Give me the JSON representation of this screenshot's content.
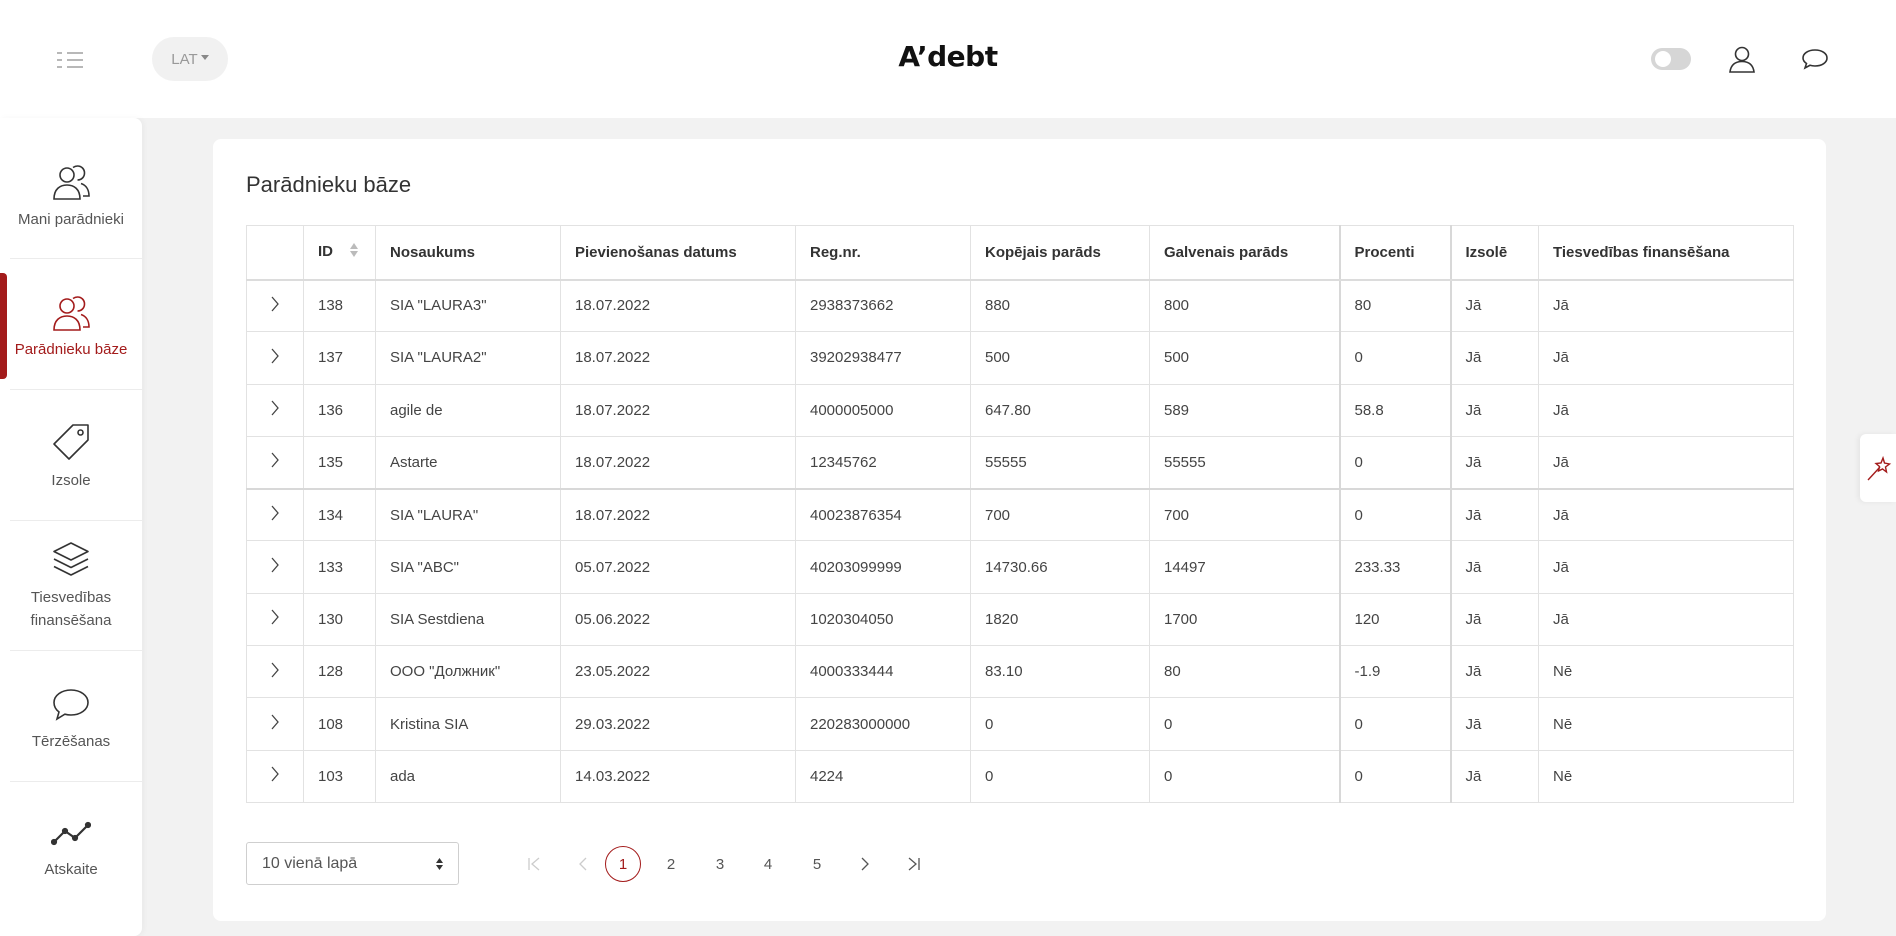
{
  "header": {
    "logo": "A’debt",
    "language": "LAT",
    "icons": {
      "menu": "list-menu-icon",
      "user": "user-icon",
      "chat": "chat-bubble-icon"
    },
    "theme_toggle_on": false
  },
  "sidebar": {
    "items": [
      {
        "label": "Mani parādnieki",
        "icon": "users-icon",
        "active": false
      },
      {
        "label": "Parādnieku bāze",
        "icon": "users-icon",
        "active": true
      },
      {
        "label": "Izsole",
        "icon": "tag-icon",
        "active": false
      },
      {
        "label": "Tiesvedības finansēšana",
        "line1": "Tiesvedības",
        "line2": "finansēšana",
        "icon": "layers-icon",
        "active": false
      },
      {
        "label": "Tērzēšanas",
        "icon": "chat-bubble-icon",
        "active": false
      },
      {
        "label": "Atskaite",
        "icon": "line-chart-icon",
        "active": false
      }
    ]
  },
  "main": {
    "title": "Parādnieku bāze",
    "columns": [
      "",
      "ID",
      "Nosaukums",
      "Pievienošanas datums",
      "Reg.nr.",
      "Kopējais parāds",
      "Galvenais parāds",
      "Procenti",
      "Izsolē",
      "Tiesvedības finansēšana"
    ],
    "rows": [
      [
        "138",
        "SIA \"LAURA3\"",
        "18.07.2022",
        "2938373662",
        "880",
        "800",
        "80",
        "Jā",
        "Jā"
      ],
      [
        "137",
        "SIA \"LAURA2\"",
        "18.07.2022",
        "39202938477",
        "500",
        "500",
        "0",
        "Jā",
        "Jā"
      ],
      [
        "136",
        "agile de",
        "18.07.2022",
        "4000005000",
        "647.80",
        "589",
        "58.8",
        "Jā",
        "Jā"
      ],
      [
        "135",
        "Astarte",
        "18.07.2022",
        "12345762",
        "55555",
        "55555",
        "0",
        "Jā",
        "Jā"
      ],
      [
        "134",
        "SIA \"LAURA\"",
        "18.07.2022",
        "40023876354",
        "700",
        "700",
        "0",
        "Jā",
        "Jā"
      ],
      [
        "133",
        "SIA \"ABC\"",
        "05.07.2022",
        "40203099999",
        "14730.66",
        "14497",
        "233.33",
        "Jā",
        "Jā"
      ],
      [
        "130",
        "SIA Sestdiena",
        "05.06.2022",
        "1020304050",
        "1820",
        "1700",
        "120",
        "Jā",
        "Jā"
      ],
      [
        "128",
        "OOO \"Должник\"",
        "23.05.2022",
        "4000333444",
        "83.10",
        "80",
        "-1.9",
        "Jā",
        "Nē"
      ],
      [
        "108",
        "Kristina SIA",
        "29.03.2022",
        "220283000000",
        "0",
        "0",
        "0",
        "Jā",
        "Nē"
      ],
      [
        "103",
        "ada",
        "14.03.2022",
        "4224",
        "0",
        "0",
        "0",
        "Jā",
        "Nē"
      ]
    ],
    "pagination": {
      "per_page": "10 vienā lapā",
      "pages": [
        "1",
        "2",
        "3",
        "4",
        "5"
      ],
      "current": "1"
    }
  },
  "colors": {
    "accent": "#a31b1b",
    "background": "#f2f2f2"
  }
}
